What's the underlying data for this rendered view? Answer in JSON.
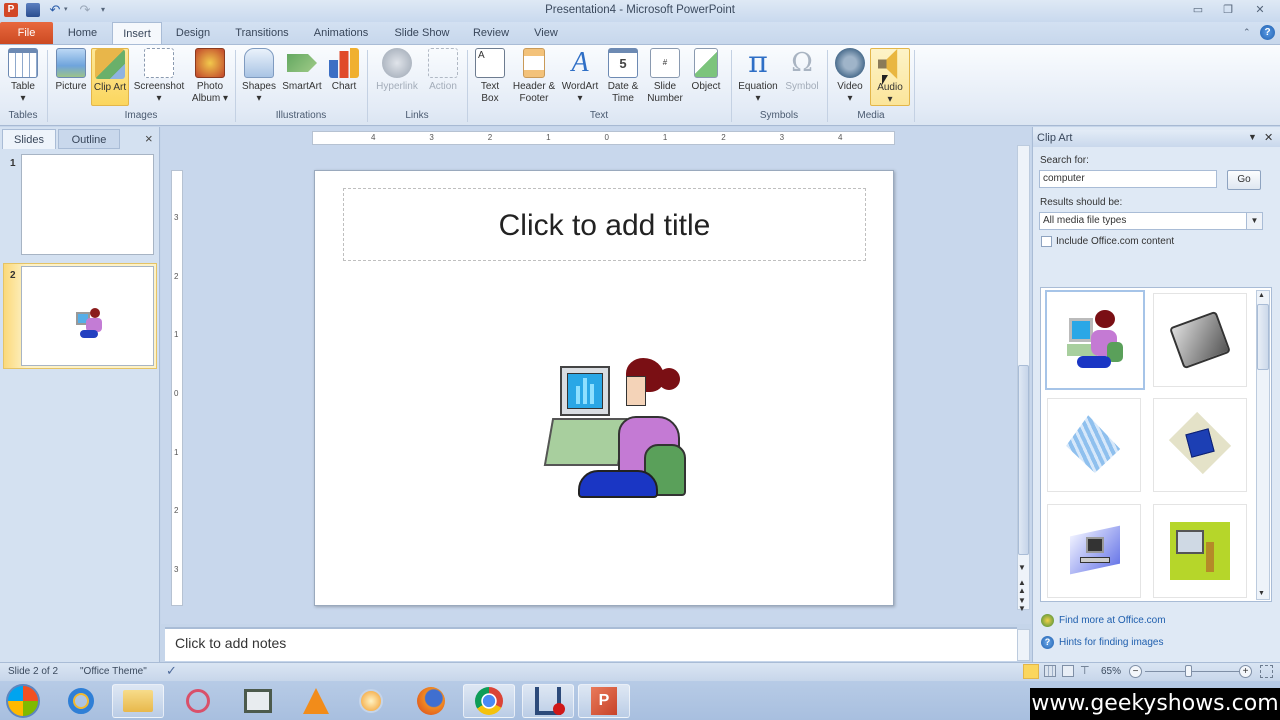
{
  "window": {
    "title": "Presentation4 - Microsoft PowerPoint",
    "controls": [
      "minimize",
      "restore",
      "close"
    ]
  },
  "quick_access": [
    "powerpoint-logo",
    "save",
    "undo",
    "redo",
    "customize"
  ],
  "tabs": [
    {
      "label": "File",
      "active": false
    },
    {
      "label": "Home",
      "active": false
    },
    {
      "label": "Insert",
      "active": true
    },
    {
      "label": "Design",
      "active": false
    },
    {
      "label": "Transitions",
      "active": false
    },
    {
      "label": "Animations",
      "active": false
    },
    {
      "label": "Slide Show",
      "active": false
    },
    {
      "label": "Review",
      "active": false
    },
    {
      "label": "View",
      "active": false
    }
  ],
  "ribbon": {
    "groups": [
      {
        "label": "Tables",
        "buttons": [
          {
            "label": "Table",
            "dropdown": true
          }
        ]
      },
      {
        "label": "Images",
        "buttons": [
          {
            "label": "Picture"
          },
          {
            "label": "Clip Art",
            "selected": true
          },
          {
            "label": "Screenshot",
            "dropdown": true
          },
          {
            "label": "Photo Album",
            "dropdown": true
          }
        ]
      },
      {
        "label": "Illustrations",
        "buttons": [
          {
            "label": "Shapes",
            "dropdown": true
          },
          {
            "label": "SmartArt"
          },
          {
            "label": "Chart"
          }
        ]
      },
      {
        "label": "Links",
        "buttons": [
          {
            "label": "Hyperlink",
            "disabled": true
          },
          {
            "label": "Action",
            "disabled": true
          }
        ]
      },
      {
        "label": "Text",
        "buttons": [
          {
            "label": "Text Box"
          },
          {
            "label": "Header & Footer"
          },
          {
            "label": "WordArt",
            "dropdown": true
          },
          {
            "label": "Date & Time"
          },
          {
            "label": "Slide Number"
          },
          {
            "label": "Object"
          }
        ]
      },
      {
        "label": "Symbols",
        "buttons": [
          {
            "label": "Equation",
            "dropdown": true
          },
          {
            "label": "Symbol",
            "disabled": true
          }
        ]
      },
      {
        "label": "Media",
        "buttons": [
          {
            "label": "Video",
            "dropdown": true
          },
          {
            "label": "Audio",
            "dropdown": true,
            "hover": true
          }
        ]
      }
    ]
  },
  "left_pane": {
    "tabs": [
      "Slides",
      "Outline"
    ],
    "close": "×",
    "slides": [
      {
        "number": "1",
        "selected": false
      },
      {
        "number": "2",
        "selected": true
      }
    ]
  },
  "rulers": {
    "horizontal_ticks": [
      "4",
      "3",
      "2",
      "1",
      "0",
      "1",
      "2",
      "3",
      "4"
    ],
    "vertical_ticks": [
      "3",
      "2",
      "1",
      "0",
      "1",
      "2",
      "3"
    ]
  },
  "slide": {
    "title_placeholder": "Click to add title",
    "inserted_clip": "woman at computer"
  },
  "notes": {
    "placeholder": "Click to add notes"
  },
  "clip_art_pane": {
    "title": "Clip Art",
    "search_label": "Search for:",
    "search_value": "computer",
    "go_label": "Go",
    "results_label": "Results should be:",
    "results_value": "All media file types",
    "include_office_label": "Include Office.com content",
    "include_office_checked": false,
    "results": [
      "woman at computer",
      "gray fax machine",
      "blue circuit board",
      "blue floppy disk",
      "computer network",
      "computer on green background"
    ],
    "links": [
      {
        "label": "Find more at Office.com",
        "icon": "globe-icon"
      },
      {
        "label": "Hints for finding images",
        "icon": "help-icon"
      }
    ]
  },
  "status_bar": {
    "slide_info": "Slide 2 of 2",
    "theme": "\"Office Theme\"",
    "zoom": "65%",
    "zoom_fraction": 0.46
  },
  "taskbar": {
    "items": [
      "start",
      "internet-explorer",
      "file-explorer",
      "snipping-tool",
      "ebook-reader",
      "vlc",
      "media-player",
      "firefox",
      "chrome",
      "recorder",
      "powerpoint"
    ]
  },
  "watermark": "www.geekyshows.com",
  "colors": {
    "file_tab": "#d9532b",
    "selected_button": "#fbd65e",
    "ribbon_bg": "#e3ebf6",
    "link": "#1f5fae"
  }
}
